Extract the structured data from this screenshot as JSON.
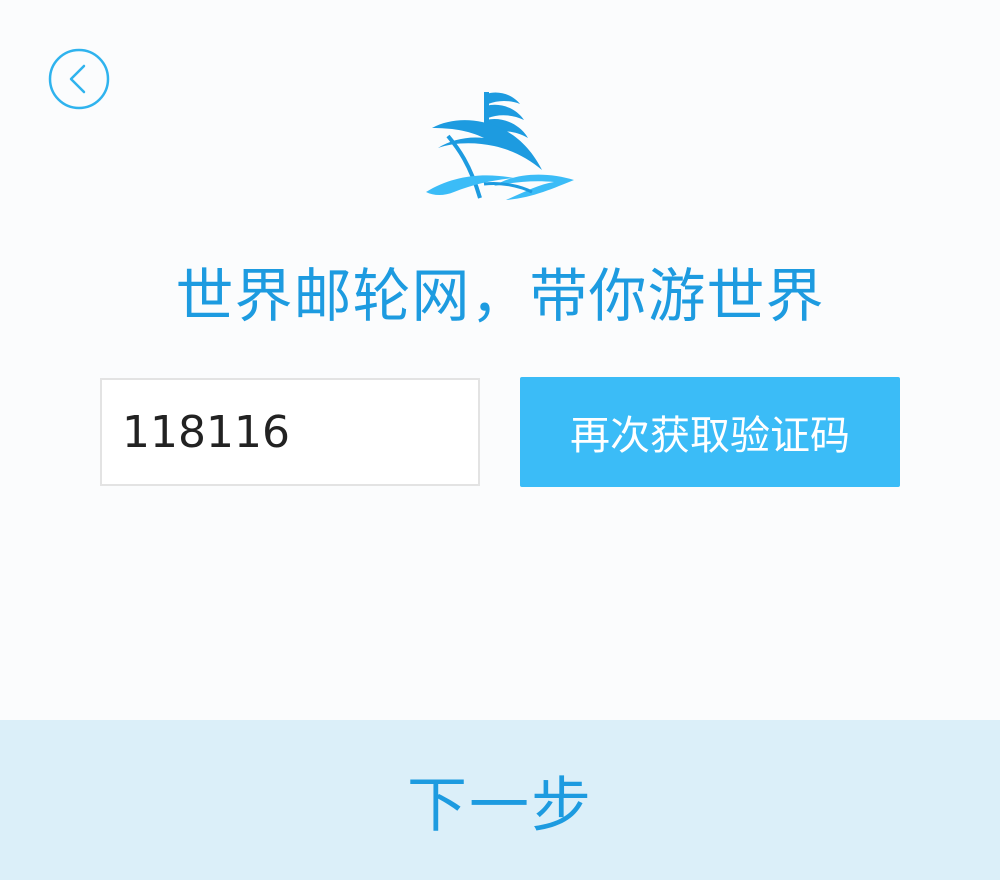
{
  "nav": {
    "back_icon": "chevron-left-circle-icon"
  },
  "brand": {
    "logo_icon": "cruise-ship-logo-icon",
    "slogan": "世界邮轮网，带你游世界"
  },
  "form": {
    "code_value": "118116",
    "resend_label": "再次获取验证码"
  },
  "footer": {
    "next_label": "下一步"
  },
  "colors": {
    "accent": "#1d9be0",
    "button": "#3bbcf7",
    "footer_bg": "#dbeff9",
    "page_bg": "#fbfcfd"
  }
}
